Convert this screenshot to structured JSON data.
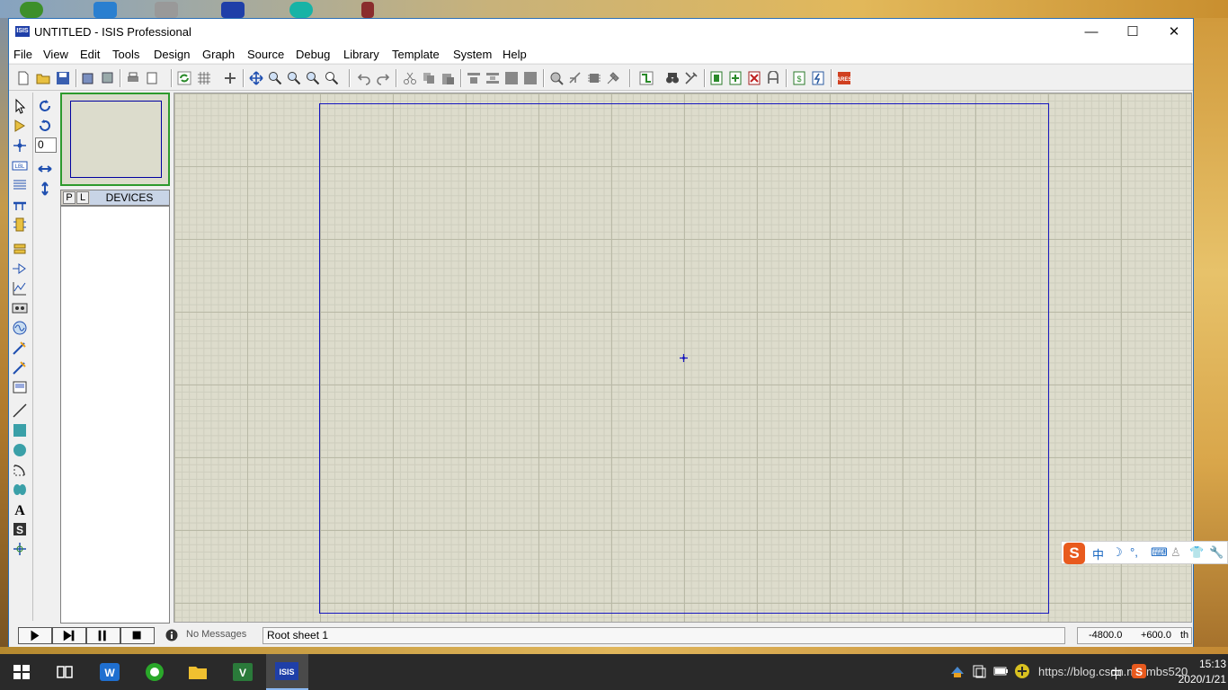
{
  "window": {
    "title": "UNTITLED - ISIS Professional",
    "icon_label": "ISIS",
    "minimize": "—",
    "maximize": "☐",
    "close": "✕"
  },
  "menu": [
    "File",
    "View",
    "Edit",
    "Tools",
    "Design",
    "Graph",
    "Source",
    "Debug",
    "Library",
    "Template",
    "System",
    "Help"
  ],
  "left_panel": {
    "rotation_value": "0",
    "device_tabs": [
      "P",
      "L"
    ],
    "devices_label": "DEVICES"
  },
  "status": {
    "messages": "No Messages",
    "sheet": "Root sheet 1",
    "coord_x": "-4800.0",
    "coord_y": "+600.0",
    "units": "th"
  },
  "ime": {
    "logo": "S",
    "mode": "中",
    "symbols": [
      "☽",
      "°,",
      "⌨",
      "♙",
      "👕",
      "🔧"
    ]
  },
  "taskbar": {
    "time": "15:13",
    "date": "2020/1/21",
    "watermark": "https://blog.csdn.net/mbs520",
    "tray_input": "中"
  },
  "colors": {
    "canvas_bg": "#dddccc",
    "sheet_border": "#1515c0",
    "overview_border": "#2d9a2d",
    "title_accent": "#1f3fa8"
  }
}
